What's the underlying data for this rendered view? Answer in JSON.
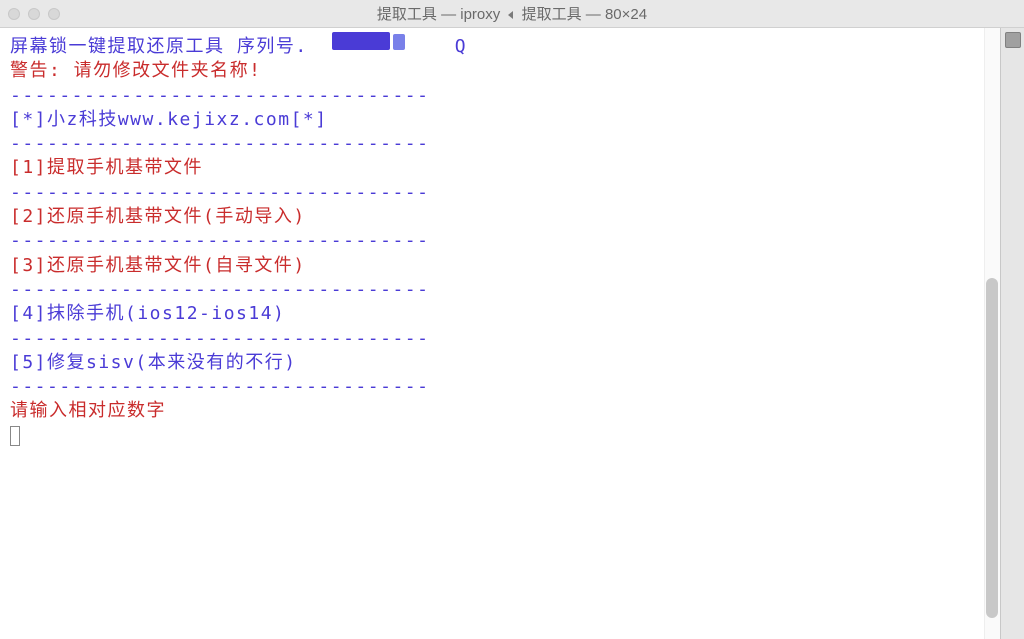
{
  "window": {
    "title_part1": "提取工具 — iproxy",
    "title_part2": "提取工具 — 80×24"
  },
  "terminal": {
    "header_prefix": "屏幕锁一键提取还原工具 序列号.",
    "header_suffix": "Q",
    "warning": "警告: 请勿修改文件夹名称!",
    "divider": "----------------------------------",
    "company": "[*]小z科技www.kejixz.com[*]",
    "option1": "[1]提取手机基带文件",
    "option2": "[2]还原手机基带文件(手动导入)",
    "option3": "[3]还原手机基带文件(自寻文件)",
    "option4": "[4]抹除手机(ios12-ios14)",
    "option5": "[5]修复sisv(本来没有的不行)",
    "prompt": "请输入相对应数字"
  }
}
